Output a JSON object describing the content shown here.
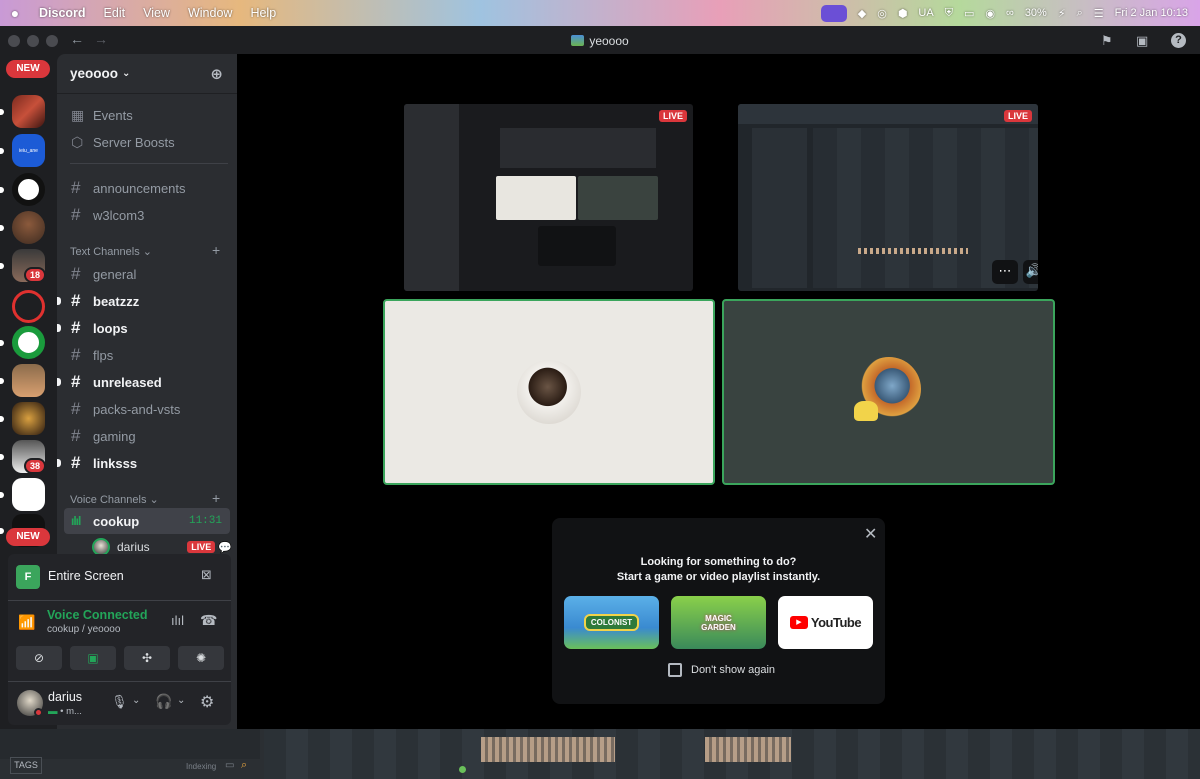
{
  "menubar": {
    "app_name": "Discord",
    "menus": [
      "Edit",
      "View",
      "Window",
      "Help"
    ],
    "input_source": "UA",
    "battery": "30%",
    "datetime": "Fri 2 Jan  10:13"
  },
  "titlebar": {
    "title": "yeoooo"
  },
  "rail": {
    "badges": [
      "18",
      "38"
    ],
    "new_label": "NEW"
  },
  "sidebar": {
    "server_name": "yeoooo",
    "top_items": [
      "Events",
      "Server Boosts"
    ],
    "pinned_channels": [
      "announcements",
      "w3lcom3"
    ],
    "text_category": "Text Channels",
    "text_channels": [
      {
        "name": "general",
        "unread": false
      },
      {
        "name": "beatzzz",
        "unread": true
      },
      {
        "name": "loops",
        "unread": true
      },
      {
        "name": "flps",
        "unread": false
      },
      {
        "name": "unreleased",
        "unread": true
      },
      {
        "name": "packs-and-vsts",
        "unread": false
      },
      {
        "name": "gaming",
        "unread": false
      },
      {
        "name": "linksss",
        "unread": true
      }
    ],
    "voice_category": "Voice Channels",
    "voice_channel": {
      "name": "cookup",
      "elapsed": "11:31"
    },
    "voice_member": {
      "name": "darius",
      "live": "LIVE"
    }
  },
  "voice_panel": {
    "share_title": "Entire Screen",
    "status": "Voice Connected",
    "location": "cookup / yeoooo"
  },
  "user": {
    "name": "darius",
    "status": "m..."
  },
  "stage": {
    "live_label": "LIVE"
  },
  "activity_popup": {
    "line1": "Looking for something to do?",
    "line2": "Start a game or video playlist instantly.",
    "activities": [
      "COLONIST",
      "MAGIC GARDEN",
      "YouTube"
    ],
    "dont_show": "Don't show again"
  },
  "bottom_strip": {
    "tags": "TAGS",
    "indexing": "Indexing"
  },
  "colors": {
    "accent_green": "#23a559",
    "live_red": "#da373c",
    "stage_bg": "#000000",
    "sidebar_bg": "#2b2d31"
  }
}
